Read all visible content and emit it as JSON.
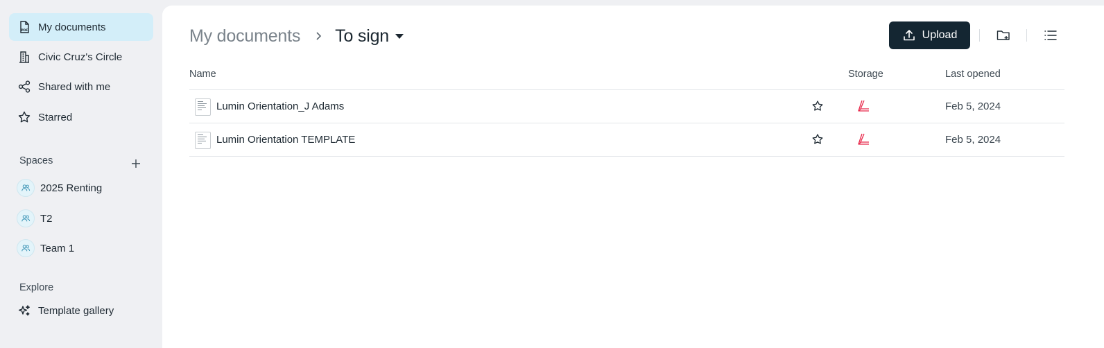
{
  "sidebar": {
    "items": [
      {
        "label": "My documents",
        "icon": "pdf-file-icon",
        "active": true
      },
      {
        "label": "Civic Cruz's Circle",
        "icon": "building-icon",
        "active": false
      },
      {
        "label": "Shared with me",
        "icon": "share-icon",
        "active": false
      },
      {
        "label": "Starred",
        "icon": "star-icon",
        "active": false
      }
    ],
    "spaces_label": "Spaces",
    "spaces": [
      {
        "label": "2025 Renting"
      },
      {
        "label": "T2"
      },
      {
        "label": "Team 1"
      }
    ],
    "explore_label": "Explore",
    "template_gallery": {
      "label": "Template gallery",
      "icon": "sparkle-icon"
    }
  },
  "header": {
    "breadcrumb_root": "My documents",
    "breadcrumb_current": "To sign",
    "upload_label": "Upload"
  },
  "table": {
    "columns": {
      "name": "Name",
      "storage": "Storage",
      "last_opened": "Last opened"
    },
    "rows": [
      {
        "name": "Lumin Orientation_J Adams",
        "last_opened": "Feb 5, 2024",
        "storage": "lumin-storage-icon"
      },
      {
        "name": "Lumin Orientation TEMPLATE",
        "last_opened": "Feb 5, 2024",
        "storage": "lumin-storage-icon"
      }
    ]
  },
  "colors": {
    "active_nav": "#d3eef9",
    "upload_bg": "#142632",
    "lumin_red": "#e8284a"
  }
}
